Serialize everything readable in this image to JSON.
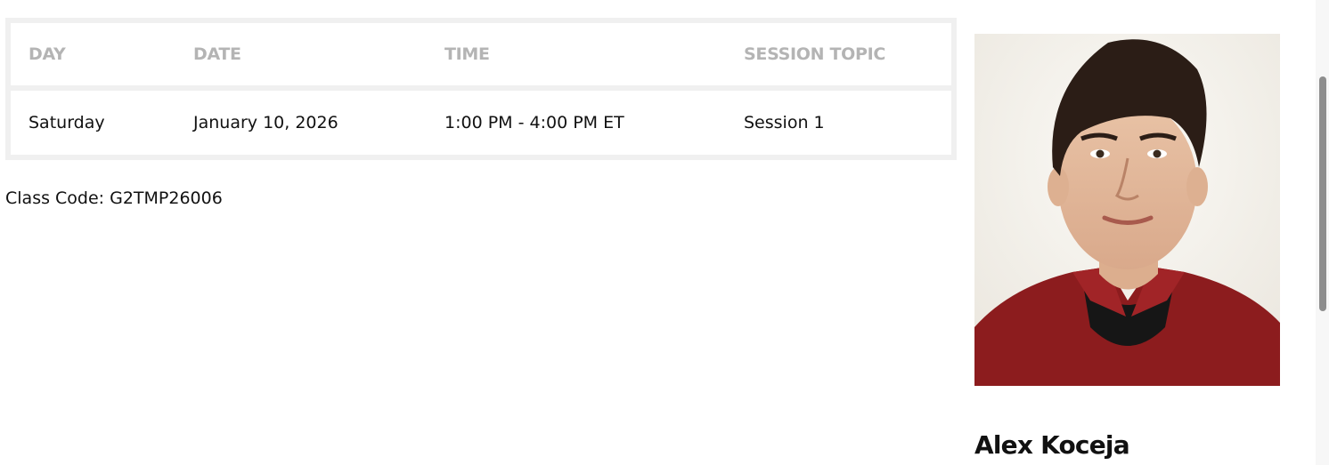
{
  "schedule": {
    "headers": {
      "day": "DAY",
      "date": "DATE",
      "time": "TIME",
      "topic": "SESSION TOPIC"
    },
    "rows": [
      {
        "day": "Saturday",
        "date": "January 10, 2026",
        "time": "1:00 PM - 4:00 PM ET",
        "topic": "Session 1"
      }
    ]
  },
  "class_code": "Class Code: G2TMP26006",
  "instructor": {
    "name": "Alex Koceja",
    "photo_icon": "instructor-photo"
  },
  "colors": {
    "table_border": "#f0f0f0",
    "header_text": "#b4b4b4",
    "body_text": "#111111",
    "shirt": "#8c1c1e"
  }
}
